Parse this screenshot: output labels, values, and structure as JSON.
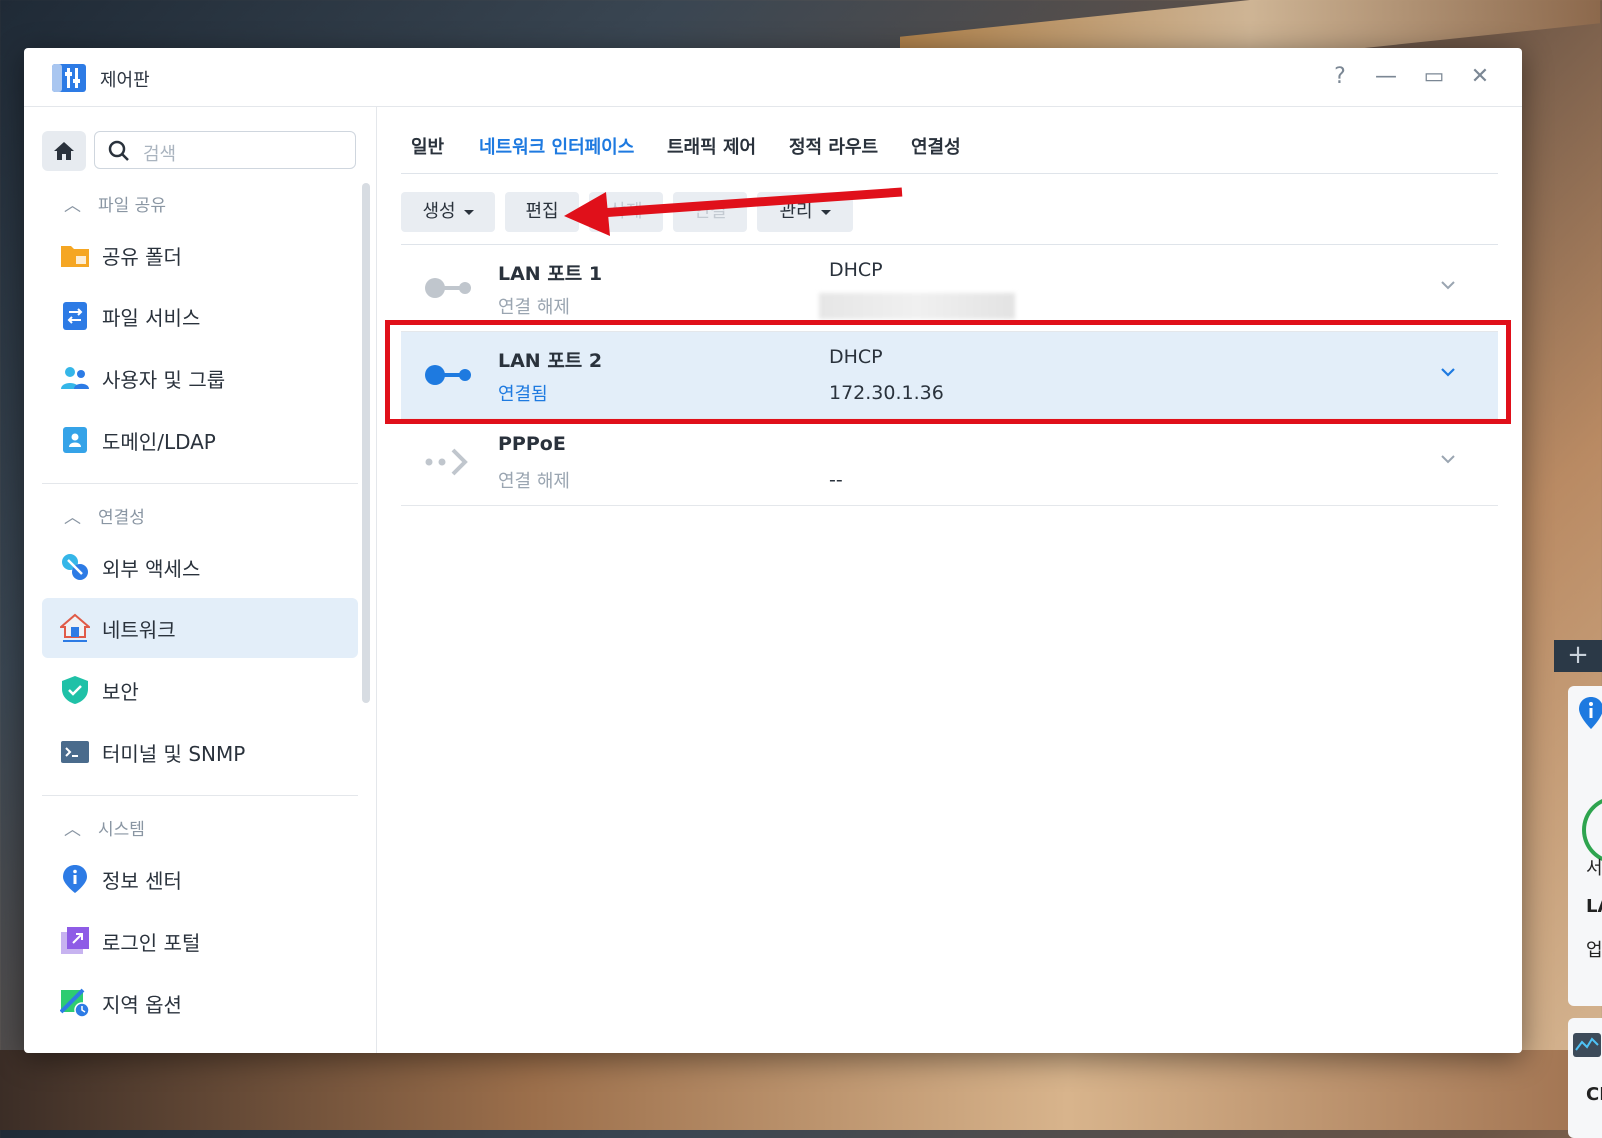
{
  "window": {
    "title": "제어판",
    "controls": {
      "help": "?",
      "minimize": "—",
      "maximize": "▭",
      "close": "✕"
    }
  },
  "sidebar": {
    "search_placeholder": "검색",
    "sections": [
      {
        "title": "파일 공유",
        "items": [
          "공유 폴더",
          "파일 서비스",
          "사용자 및 그룹",
          "도메인/LDAP"
        ]
      },
      {
        "title": "연결성",
        "items": [
          "외부 액세스",
          "네트워크",
          "보안",
          "터미널 및 SNMP"
        ]
      },
      {
        "title": "시스템",
        "items": [
          "정보 센터",
          "로그인 포털",
          "지역 옵션"
        ]
      }
    ],
    "active_item": "네트워크"
  },
  "tabs": [
    "일반",
    "네트워크 인터페이스",
    "트래픽 제어",
    "정적 라우트",
    "연결성"
  ],
  "active_tab": "네트워크 인터페이스",
  "toolbar": {
    "create": "생성",
    "edit": "편집",
    "delete": "삭제",
    "connect": "연결",
    "manage": "관리"
  },
  "interfaces": [
    {
      "name": "LAN 포트 1",
      "status": "연결 해제",
      "type": "DHCP",
      "ip": ""
    },
    {
      "name": "LAN 포트 2",
      "status": "연결됨",
      "type": "DHCP",
      "ip": "172.30.1.36"
    },
    {
      "name": "PPPoE",
      "status": "연결 해제",
      "type": "",
      "ip": "--"
    }
  ],
  "side_widget": {
    "plus": "+",
    "text1": "서",
    "text2": "LA",
    "text3": "업",
    "text4": "CF"
  },
  "colors": {
    "accent": "#1e7ae0",
    "highlight": "#e0101a",
    "selected_bg": "#e3eef9"
  }
}
